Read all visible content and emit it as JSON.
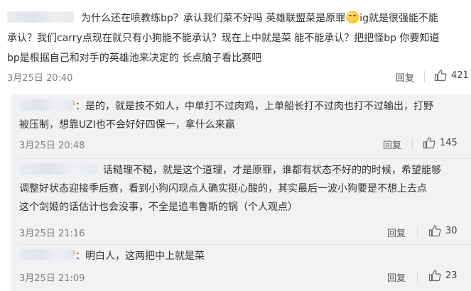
{
  "main": {
    "text_line1": "为什么还在喷教练bp？承认我们菜不好吗 英雄联盟菜是原罪",
    "text_line1b": "ig就是很强能不能",
    "text_line2": "承认？我们carry点现在就只有小狗能不能承认？现在上中就是菜 能不能承认？把把怪bp 你要知道",
    "text_line3": "bp是根据自己和对手的英雄池来决定的 长点脑子看比赛吧",
    "date": "3月25日 20:40",
    "reply_label": "回复",
    "likes": "421"
  },
  "replies": [
    {
      "line1": "：是的，就是技不如人，中单打不过肉鸡，上单船长打不过肉也打不过输出，打野",
      "line2": "被压制，想靠UZI也不会好好四保一，拿什么来赢",
      "date": "3月25日 20:48",
      "reply_label": "回复",
      "likes": "145"
    },
    {
      "line1": "话糙理不糙，就是这个道理，才是原罪，谁都有状态不好的的时候，希望能够",
      "line2": "调整好状态迎接季后赛，看到小狗闪现点人确实挺心酸的，其实最后一波小狗要是不想上去点",
      "line3": "这个剑姬的话估计也会没事，不全是追韦鲁斯的锅（个人观点）",
      "date": "3月25日 21:16",
      "reply_label": "回复",
      "likes": "30"
    },
    {
      "line1": "：明白人，这两把中上就是菜",
      "date": "3月25日 21:09",
      "reply_label": "回复",
      "likes": "23"
    }
  ],
  "icons": {
    "like": "thumbs-up-icon",
    "emoji": "smile-emoji-icon"
  }
}
